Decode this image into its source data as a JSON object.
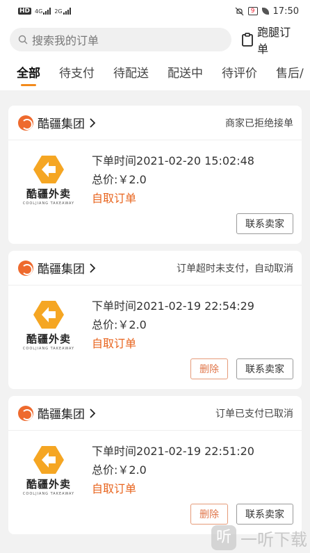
{
  "status_bar": {
    "net_badge": "HD",
    "net1": "4G",
    "net2": "2G",
    "battery": "9",
    "time": "17:50"
  },
  "search": {
    "placeholder": "搜索我的订单"
  },
  "errand": {
    "label": "跑腿订单"
  },
  "tabs": [
    "全部",
    "待支付",
    "待配送",
    "配送中",
    "待评价",
    "售后/"
  ],
  "brand": {
    "name": "酷疆外卖",
    "sub": "COOLJIANG TAKEAWAY",
    "color": "#f5a623"
  },
  "accent_color": "#f28a1c",
  "orders": [
    {
      "shop": "酷疆集团",
      "status": "商家已拒绝接单",
      "time_label": "下单时间",
      "time": "2021-02-20 15:02:48",
      "price": "总价:￥2.0",
      "mode": "自取订单",
      "actions": [
        "联系卖家"
      ]
    },
    {
      "shop": "酷疆集团",
      "status": "订单超时未支付，自动取消",
      "time_label": "下单时间",
      "time": "2021-02-19 22:54:29",
      "price": "总价:￥2.0",
      "mode": "自取订单",
      "actions": [
        "删除",
        "联系卖家"
      ]
    },
    {
      "shop": "酷疆集团",
      "status": "订单已支付已取消",
      "time_label": "下单时间",
      "time": "2021-02-19 22:51:20",
      "price": "总价:￥2.0",
      "mode": "自取订单",
      "actions": [
        "删除",
        "联系卖家"
      ]
    }
  ],
  "watermark": {
    "text": "一听下载",
    "icon": "听"
  }
}
